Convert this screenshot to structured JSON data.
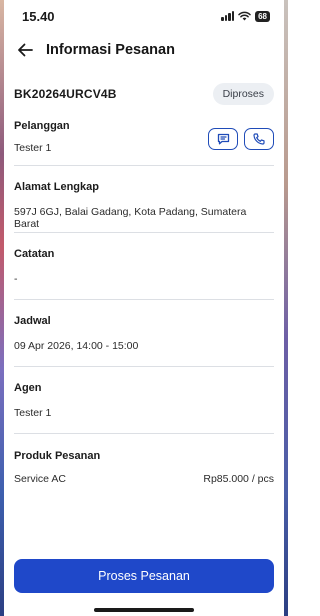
{
  "status_bar": {
    "time": "15.40",
    "battery": "68"
  },
  "header": {
    "title": "Informasi Pesanan"
  },
  "order": {
    "id": "BK20264URCV4B",
    "status": "Diproses"
  },
  "customer": {
    "label": "Pelanggan",
    "value": "Tester 1"
  },
  "address": {
    "label": "Alamat Lengkap",
    "value": "597J 6GJ, Balai Gadang, Kota Padang, Sumatera Barat"
  },
  "notes": {
    "label": "Catatan",
    "value": "-"
  },
  "schedule": {
    "label": "Jadwal",
    "value": "09 Apr 2026, 14:00 - 15:00"
  },
  "agent": {
    "label": "Agen",
    "value": "Tester 1"
  },
  "products": {
    "label": "Produk Pesanan",
    "items": [
      {
        "name": "Service AC",
        "price": "Rp85.000 / pcs"
      }
    ]
  },
  "actions": {
    "process_label": "Proses Pesanan"
  },
  "colors": {
    "primary": "#1f48c9",
    "badge_bg": "#eceff3"
  },
  "icons": {
    "back": "arrow-left-icon",
    "chat": "chat-icon",
    "phone": "phone-icon",
    "wifi": "wifi-icon",
    "signal": "signal-icon"
  }
}
